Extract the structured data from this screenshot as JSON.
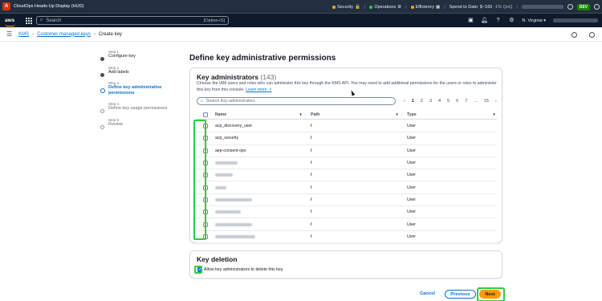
{
  "hud": {
    "title": "CloudOps Heads-Up Display (HUD)",
    "security": "Security",
    "operations": "Operations",
    "efficiency": "Efficiency",
    "spend": "Spend to Date: $~165",
    "spend_delta": "-1% QoQ",
    "env_badge": "DEV",
    "colors": {
      "security_dot": "#f5a623",
      "operations_dot": "#2ecc40",
      "efficiency_dot": "#f5a623"
    }
  },
  "nav": {
    "logo": "aws",
    "search_placeholder": "Search",
    "search_shortcut": "[Option+S]",
    "region": "N. Virginia"
  },
  "breadcrumb": {
    "items": [
      "KMS",
      "Customer managed keys"
    ],
    "current": "Create key"
  },
  "steps": [
    {
      "num": "Step 1",
      "label": "Configure key",
      "state": "done"
    },
    {
      "num": "Step 2",
      "label": "Add labels",
      "state": "done"
    },
    {
      "num": "Step 3",
      "label": "Define key administrative permissions",
      "state": "active"
    },
    {
      "num": "Step 4",
      "label": "Define key usage permissions",
      "state": "future"
    },
    {
      "num": "Step 5",
      "label": "Review",
      "state": "future"
    }
  ],
  "page": {
    "title": "Define key administrative permissions"
  },
  "admins": {
    "title": "Key administrators",
    "count": "(143)",
    "description": "Choose the IAM users and roles who can administer this key through the KMS API. You may need to add additional permissions for the users or roles to administer this key from this console.",
    "learn_more": "Learn more",
    "search_placeholder": "Search Key administrators",
    "pages": [
      "1",
      "2",
      "3",
      "4",
      "5",
      "6",
      "7",
      "...",
      "15"
    ],
    "columns": {
      "name": "Name",
      "path": "Path",
      "type": "Type"
    },
    "rows": [
      {
        "name": "acp_discovery_user",
        "path": "/",
        "type": "User"
      },
      {
        "name": "acp_security",
        "path": "/",
        "type": "User"
      },
      {
        "name": "aep-consent-ops",
        "path": "/",
        "type": "User"
      },
      {
        "name": "",
        "path": "/",
        "type": "User"
      },
      {
        "name": "",
        "path": "/",
        "type": "User"
      },
      {
        "name": "",
        "path": "/",
        "type": "User"
      },
      {
        "name": "",
        "path": "/",
        "type": "User"
      },
      {
        "name": "",
        "path": "/",
        "type": "User"
      },
      {
        "name": "",
        "path": "/",
        "type": "User"
      },
      {
        "name": "",
        "path": "/",
        "type": "User"
      }
    ]
  },
  "deletion": {
    "title": "Key deletion",
    "checkbox_label": "Allow key administrators to delete this key.",
    "checked": true
  },
  "footer": {
    "cancel": "Cancel",
    "previous": "Previous",
    "next": "Next"
  }
}
